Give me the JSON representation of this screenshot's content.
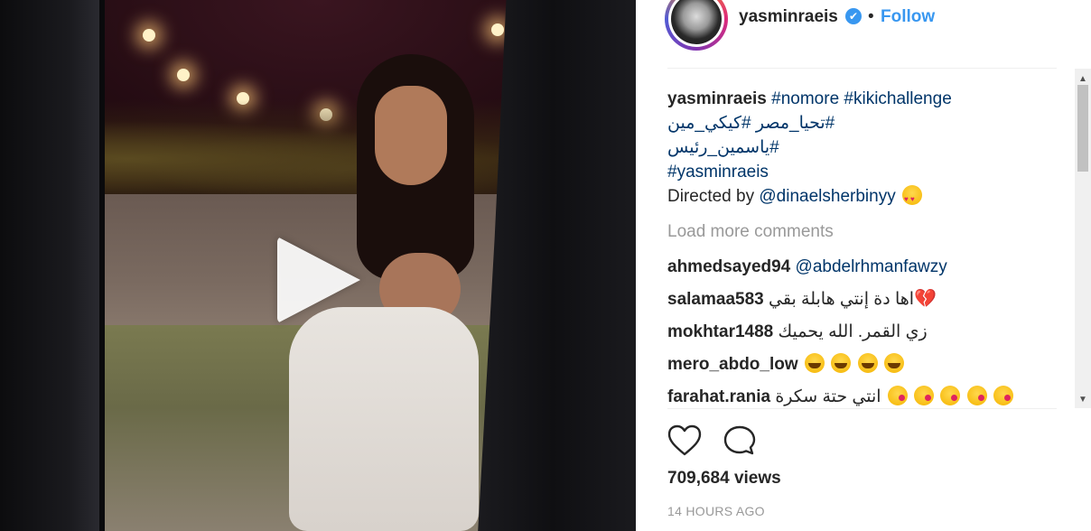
{
  "post": {
    "author": "yasminraeis",
    "separator": "•",
    "follow_label": "Follow",
    "verified_mark": "✔"
  },
  "caption": {
    "author": "yasminraeis",
    "line1_tags": "#nomore #kikichallenge",
    "line2_tags": "#تحيا_مصر   #كيكي_مين",
    "line3_tags": "#ياسمين_رئيس",
    "line4_tags": "#yasminraeis",
    "line5_text": "Directed by ",
    "line5_mention": "@dinaelsherbinyy",
    "line5_emoji": "heart-eyes-emoji"
  },
  "load_more": "Load more comments",
  "comments": [
    {
      "user": "ahmedsayed94",
      "mention": "@abdelrhmanfawzy",
      "text": ""
    },
    {
      "user": "salamaa583",
      "text": "اها دة إنتي هابلة بقي",
      "emoji": "broken-heart"
    },
    {
      "user": "mokhtar1488",
      "text": "زي القمر. الله يحميك"
    },
    {
      "user": "mero_abdo_low",
      "text": "",
      "emoji": "tears-of-joy x4"
    },
    {
      "user": "farahat.rania",
      "text": "انتي حتة سكرة",
      "emoji": "face-blowing-kiss x5"
    }
  ],
  "stats": {
    "views": "709,684 views",
    "time_ago": "14 HOURS AGO"
  },
  "icons": {
    "heartbreak_glyph": "💔"
  },
  "colors": {
    "link_blue": "#3897f0",
    "hashtag": "#003569",
    "muted": "#999999"
  }
}
